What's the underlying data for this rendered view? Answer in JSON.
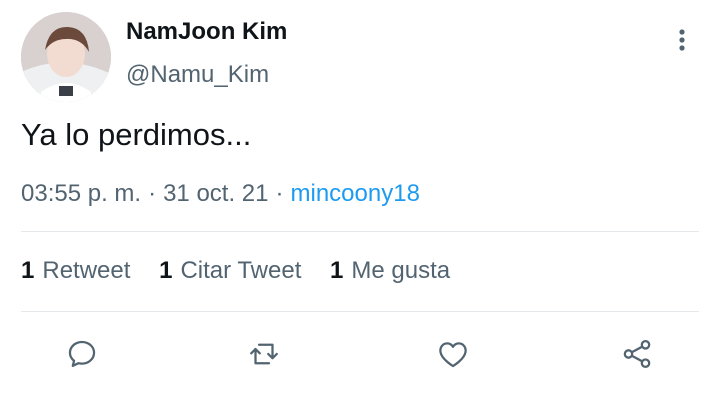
{
  "author": {
    "name": "NamJoon Kim",
    "handle": "@Namu_Kim"
  },
  "tweet": {
    "text": "Ya lo perdimos..."
  },
  "meta": {
    "time": "03:55 p. m.",
    "separator": "·",
    "date": "31 oct. 21",
    "source": "mincoony18"
  },
  "stats": {
    "retweets_count": "1",
    "retweets_label": "Retweet",
    "quotes_count": "1",
    "quotes_label": "Citar Tweet",
    "likes_count": "1",
    "likes_label": "Me gusta"
  },
  "actions": [
    "reply-icon",
    "retweet-icon",
    "like-icon",
    "share-icon"
  ],
  "colors": {
    "text": "#0f1419",
    "secondary": "#536471",
    "accent": "#1d9bf0",
    "divider": "#e6e9ec"
  }
}
